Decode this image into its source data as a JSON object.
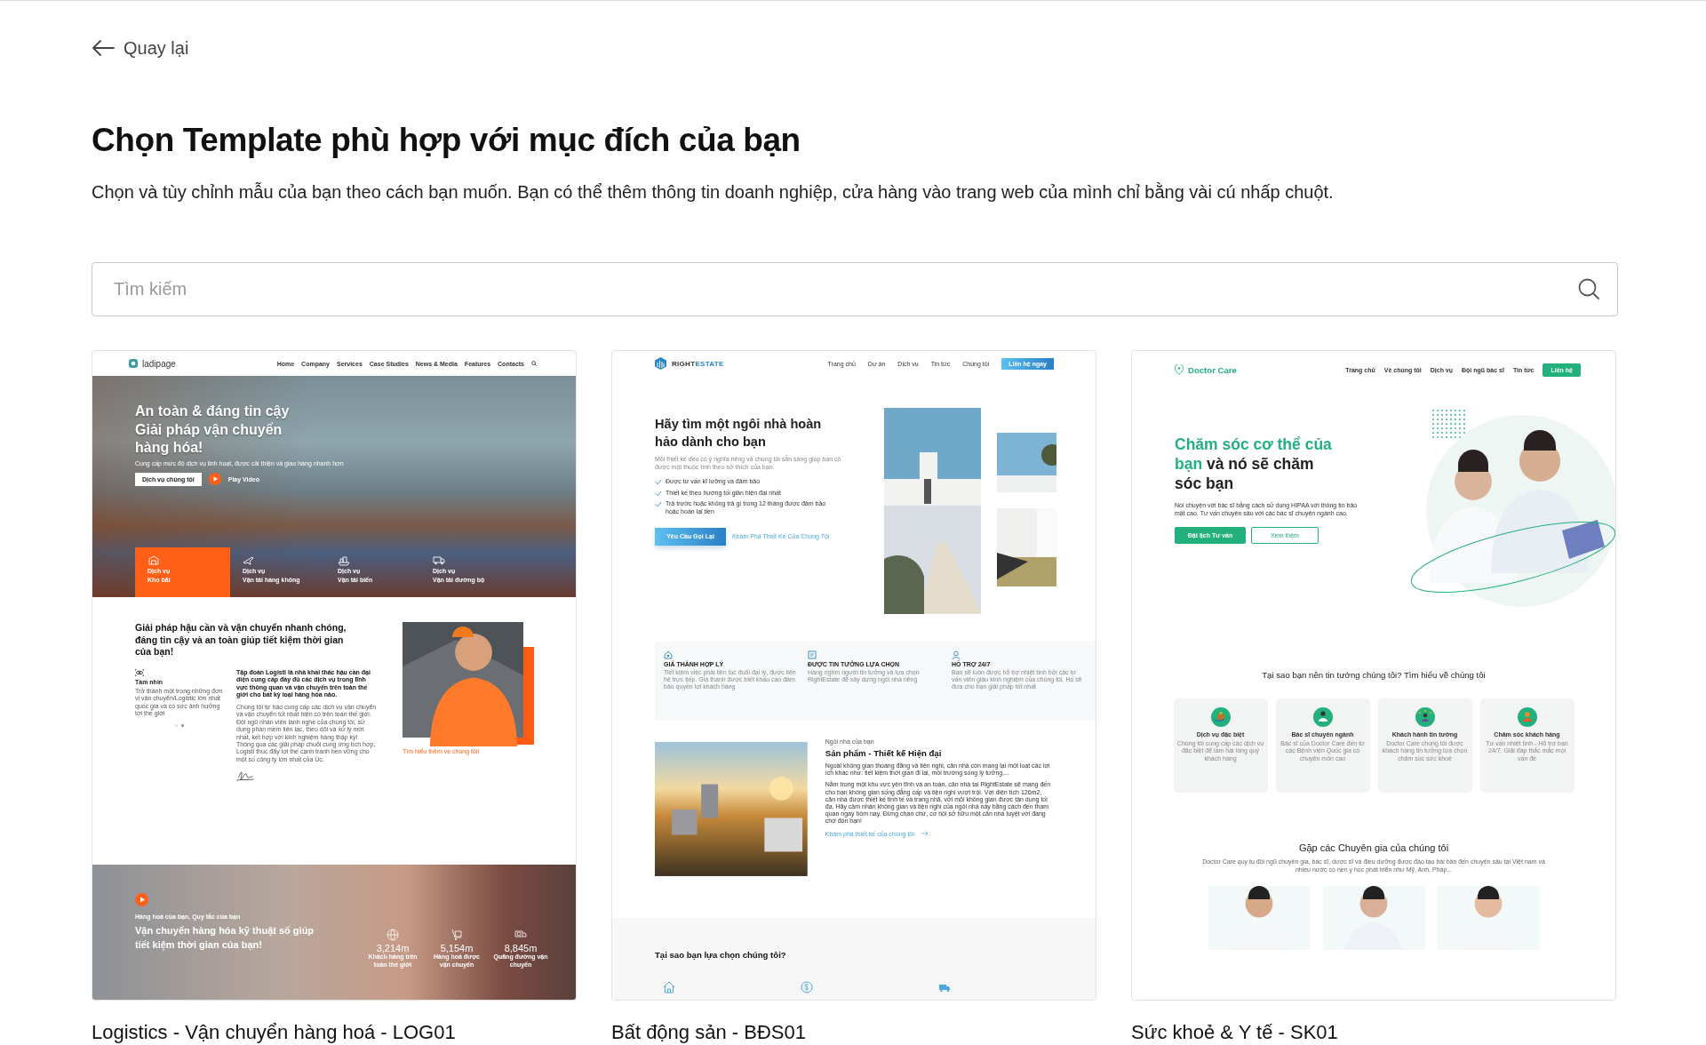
{
  "back_link": {
    "label": "Quay lại"
  },
  "page_title": "Chọn Template phù hợp với mục đích của bạn",
  "page_subtitle": "Chọn và tùy chỉnh mẫu của bạn theo cách bạn muốn. Bạn có thể thêm thông tin doanh nghiệp, cửa hàng vào trang web của mình chỉ bằng vài cú nhấp chuột.",
  "search": {
    "placeholder": "Tìm kiếm"
  },
  "templates": [
    {
      "kind": "logistics",
      "name": "Logistics - Vận chuyển hàng hoá - LOG01",
      "preview": {
        "logo": "ladipage",
        "nav": [
          "Home",
          "Company",
          "Services",
          "Case Studies",
          "News & Media",
          "Features",
          "Contacts"
        ],
        "hero": {
          "headline_lines": [
            "An toàn & đáng tin cậy",
            "Giải pháp vận chuyển",
            "hàng hóa!"
          ],
          "tagline": "Cung cấp mức độ dịch vụ linh hoạt, được cải thiện và giao hàng nhanh hơn",
          "button": "Dịch vụ chúng tôi",
          "video_label": "Play Video"
        },
        "services": [
          {
            "kicker": "Dịch vụ",
            "name": "Kho bãi",
            "selected": true
          },
          {
            "kicker": "Dịch vụ",
            "name": "Vận tải hàng không",
            "selected": false
          },
          {
            "kicker": "Dịch vụ",
            "name": "Vận tải biển",
            "selected": false
          },
          {
            "kicker": "Dịch vụ",
            "name": "Vận tải đường bộ",
            "selected": false
          }
        ],
        "about": {
          "headline": "Giải pháp hậu cần và vận chuyển nhanh chóng, đáng tin cậy và an toàn giúp tiết kiệm thời gian của bạn!",
          "vision_title": "Tầm nhìn",
          "vision_text": "Trở thành một trong những đơn vị vận chuyển/Logistic lớn nhất quốc gia và có sức ảnh hưởng tới thế giới",
          "vision_dots": [
            {
              "selected": false
            },
            {
              "selected": true
            }
          ],
          "lead": "Tập đoàn Logisti là nhà khai thác hậu cần đại diện cung cấp đầy đủ các dịch vụ trong lĩnh vực thông quan và vận chuyển trên toàn thế giới cho bất kỳ loại hàng hóa nào.",
          "body": "Chúng tôi tự hào cung cấp các dịch vụ vận chuyển và vận chuyển tốt nhất hiện có trên toàn thế giới. Đội ngũ nhân viên lành nghề của chúng tôi, sử dụng phần mềm liên lạc, theo dõi và xử lý mới nhất, kết hợp với kinh nghiệm hàng thập kỷ! Thông qua các giải pháp chuỗi cung ứng tích hợp, Logisti thúc đẩy lợi thế cạnh tranh bền vững cho một số công ty lớn nhất của Úc.",
          "photo_caption": "Tìm hiểu thêm về chúng tôi!"
        },
        "cta": {
          "kicker": "Hàng hoá của bạn, Quy tắc của bạn",
          "headline": "Vận chuyển hàng hóa kỹ thuật số giúp tiết kiệm thời gian của bạn!",
          "stats": [
            {
              "value": "3,214m",
              "label": "Khách hàng trên toàn thế giới"
            },
            {
              "value": "5,154m",
              "label": "Hàng hoá được vận chuyển"
            },
            {
              "value": "8,845m",
              "label": "Quãng đường vận chuyển"
            }
          ]
        }
      }
    },
    {
      "kind": "realestate",
      "name": "Bất động sản - BĐS01",
      "preview": {
        "brand_first": "RIGHT",
        "brand_second": "ESTATE",
        "nav": [
          "Trang chủ",
          "Dự án",
          "Dịch vụ",
          "Tin tức",
          "Chúng tôi"
        ],
        "nav_button": "Liên hệ ngay",
        "hero": {
          "headline": "Hãy tìm một ngôi nhà hoàn hảo dành cho bạn",
          "description": "Mỗi thiết kế đều có ý nghĩa riêng và chúng tôi sẵn sàng giúp bạn có được một thuộc tính theo sở thích của bạn.",
          "checklist": [
            "Được tư vấn kĩ lưỡng và đảm bảo",
            "Thiết kế theo hướng tối giản hiện đại nhất",
            "Trả trước hoặc không trả gì trong 12 tháng được đảm bảo hoặc hoàn lại tiền"
          ],
          "primary_button": "Yêu Cầu Gọi Lại",
          "secondary_link": "Khám Phá Thiết Kế Của Chúng Tôi"
        },
        "features": [
          {
            "title": "GIÁ THÀNH HỢP LÝ",
            "text": "Tiết kiệm việc phải liên tục đuổi đại lý, được liên hệ trực tiếp. Giá thành được triết khấu cao đảm bảo quyền lợi khách hàng"
          },
          {
            "title": "ĐƯỢC TIN TƯỞNG LỰA CHỌN",
            "text": "Hàng nghìn người tin tưởng và lựa chọn RightEstate để xây dựng ngôi nhà riêng"
          },
          {
            "title": "HỖ TRỢ 24/7",
            "text": "Bạn sẽ luôn được hỗ trợ nhiệt tình bởi các tư vấn viên giàu kinh nghiệm của chúng tôi. Họ sẽ đưa cho bạn giải pháp tốt nhất"
          }
        ],
        "product": {
          "kicker": "Ngôi nhà của bạn",
          "title": "Sản phẩm - Thiết kế Hiện đại",
          "paragraphs": [
            "Ngoài không gian thoáng đãng và tiện nghi, căn nhà còn mang lại một loạt các lợi ích khác như: tiết kiệm thời gian đi lại, môi trường sống lý tưởng,...",
            "Nằm trong một khu vực yên tĩnh và an toàn, căn nhà tại RightEstate sẽ mang đến cho bạn không gian sống đẳng cấp và tiện nghi vượt trội. Với diện tích 126m2, căn nhà được thiết kế tinh tế và trang nhã, với mỗi không gian được tận dụng tối đa. Hãy cảm nhận không gian và tiện nghi của ngôi nhà này bằng cách đến tham quan ngay hôm nay. Đừng chần chừ, cơ hội sở hữu một căn nhà tuyệt vời đang chờ đón bạn!"
          ],
          "link": "Khám phá thiết kế của chúng tôi"
        },
        "why": {
          "title": "Tại sao bạn lựa chọn chúng tôi?"
        }
      }
    },
    {
      "kind": "medical",
      "name": "Sức khoẻ & Y tế - SK01",
      "preview": {
        "brand": "Doctor Care",
        "nav": [
          "Trang chủ",
          "Về chúng tôi",
          "Dịch vụ",
          "Đội ngũ bác sĩ",
          "Tin tức"
        ],
        "nav_button": "Liên hệ",
        "hero": {
          "headline_accent": "Chăm sóc cơ thể của bạn",
          "headline_rest": "và nó sẽ chăm sóc bạn",
          "description": "Nói chuyện với bác sĩ bằng cách sử dụng HIPAA với thông tin bảo mật cao. Tư vấn chuyên sâu với các bác sĩ chuyên ngành cao.",
          "primary_button": "Đặt lịch Tư vấn",
          "secondary_button": "Xem thêm"
        },
        "trust": {
          "title": "Tại sao bạn nên tin tưởng chúng tôi? Tìm hiểu về chúng tôi",
          "items": [
            {
              "title": "Dịch vụ đặc biệt",
              "text": "Chúng tôi cung cấp các dịch vụ đặc biệt để làm hài lòng quý khách hàng"
            },
            {
              "title": "Bác sĩ chuyên ngành",
              "text": "Bác sĩ của Doctor Care đến từ các Bệnh viện Quốc gia có chuyên môn cao"
            },
            {
              "title": "Khách hành tin tưởng",
              "text": "Doctor Care chúng tôi được khách hàng tin tưởng lựa chọn chăm sóc sức khoẻ"
            },
            {
              "title": "Chăm sóc khách hàng",
              "text": "Tư vấn nhiệt tình - Hỗ trợ bạn 24/7. Giải đáp thắc mắc mọi vấn đề"
            }
          ]
        },
        "experts": {
          "title": "Gặp các Chuyên gia của chúng tôi",
          "description": "Doctor Care quy tụ đội ngũ chuyên gia, bác sĩ, dược sĩ và điều dưỡng được đào tạo bài bản đến chuyên sâu tại Việt nam và nhiều nước có nền y học phát triển như Mỹ, Anh, Pháp..."
        }
      }
    }
  ]
}
